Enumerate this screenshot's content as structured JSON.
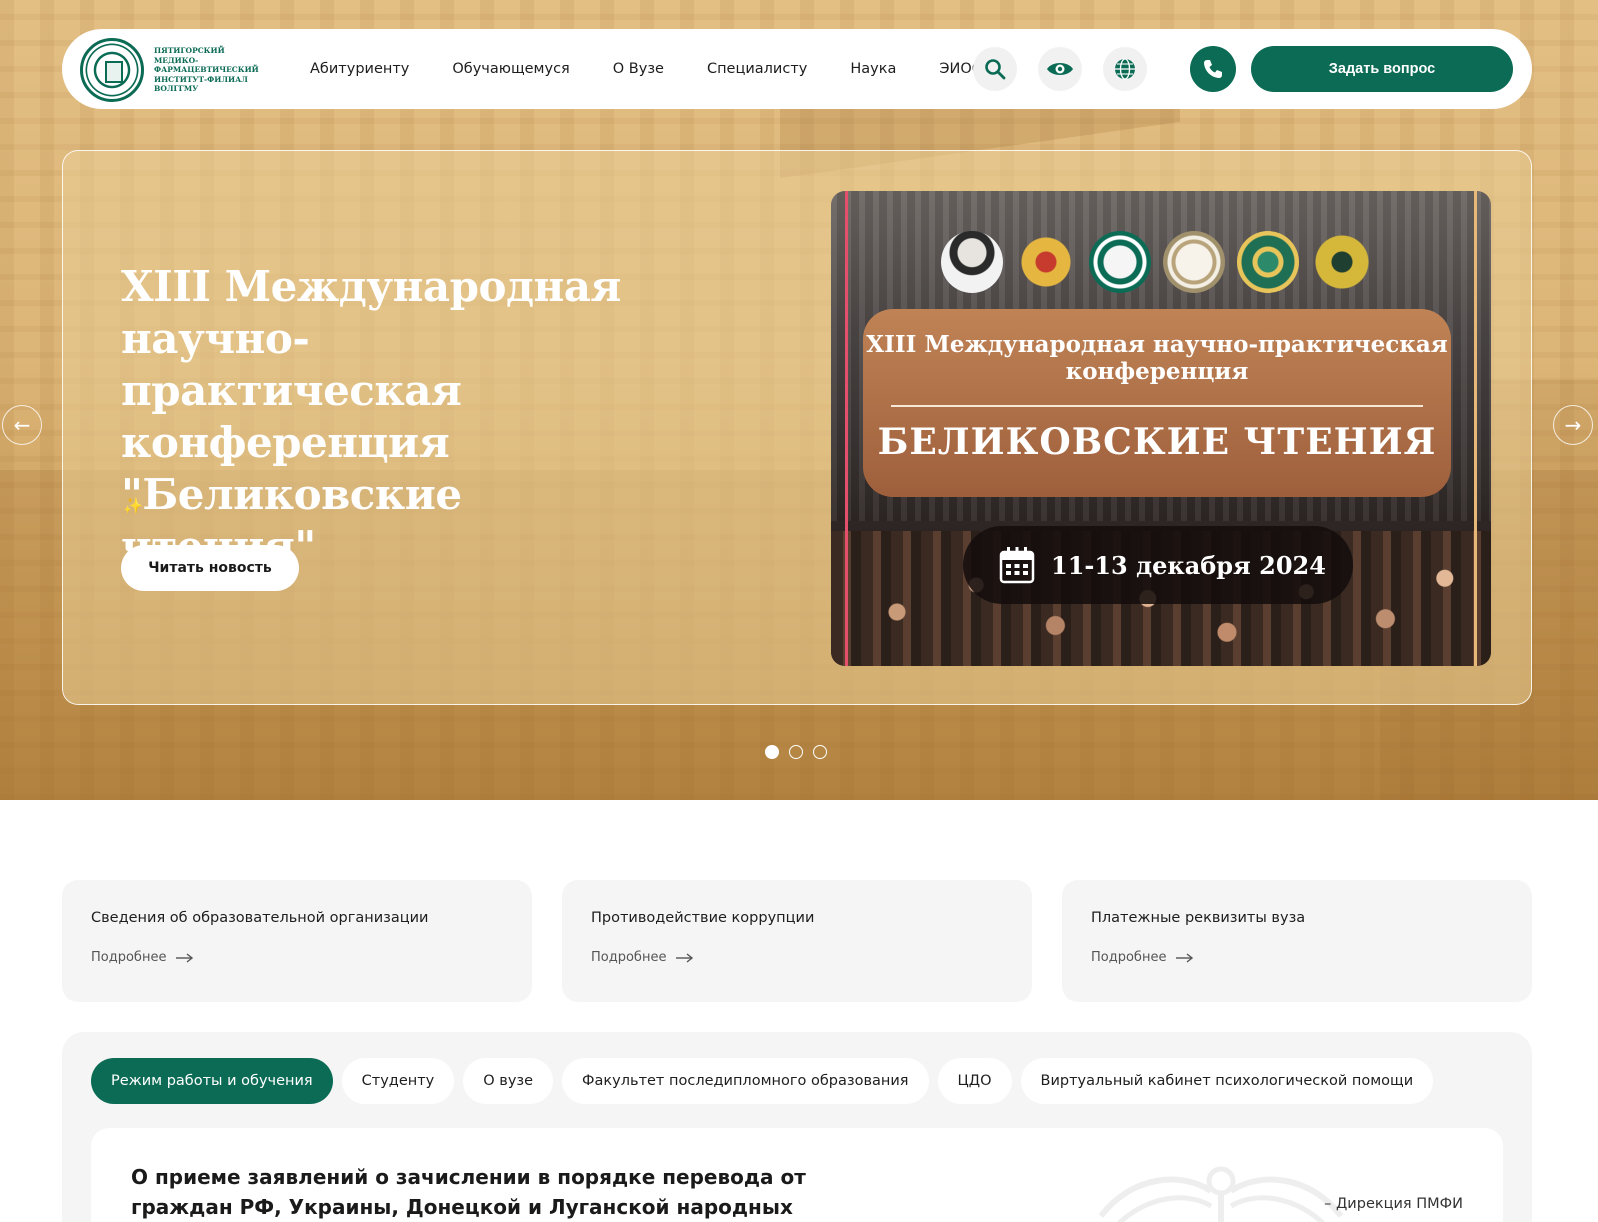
{
  "header": {
    "logo_text": "Пятигорский медико-фармацевтический институт-филиал ВолгГМУ",
    "nav": [
      "Абитуриенту",
      "Обучающемуся",
      "О Вузе",
      "Специалисту",
      "Наука",
      "ЭИОС"
    ],
    "ask_label": "Задать вопрос",
    "icons": [
      "search-icon",
      "eye-icon",
      "globe-icon",
      "phone-icon"
    ]
  },
  "slider": {
    "title": "XIII Международная научно-практическая конференция \"Беликовские чтения\"",
    "sparkle": "✨",
    "read_label": "Читать новость",
    "poster": {
      "line1": "XIII Международная научно-практическая конференция",
      "line2": "БЕЛИКОВСКИЕ ЧТЕНИЯ",
      "date": "11-13 декабря 2024"
    },
    "slides_total": 3,
    "active_slide": 1
  },
  "cards": [
    {
      "title": "Сведения об образовательной организации",
      "more": "Подробнее"
    },
    {
      "title": "Противодействие коррупции",
      "more": "Подробнее"
    },
    {
      "title": "Платежные реквизиты вуза",
      "more": "Подробнее"
    }
  ],
  "tabs": [
    "Режим работы и обучения",
    "Студенту",
    "О вузе",
    "Факультет последипломного образования",
    "ЦДО",
    "Виртуальный кабинет психологической помощи"
  ],
  "notice": {
    "title": "О приеме заявлений о зачислении в порядке перевода от граждан РФ, Украины, Донецкой и Луганской народных республик",
    "signature": "– Дирекция ПМФИ"
  },
  "colors": {
    "brand": "#0b6b55",
    "hero_bg": "#dcb577",
    "card_bg": "#f5f5f5"
  }
}
